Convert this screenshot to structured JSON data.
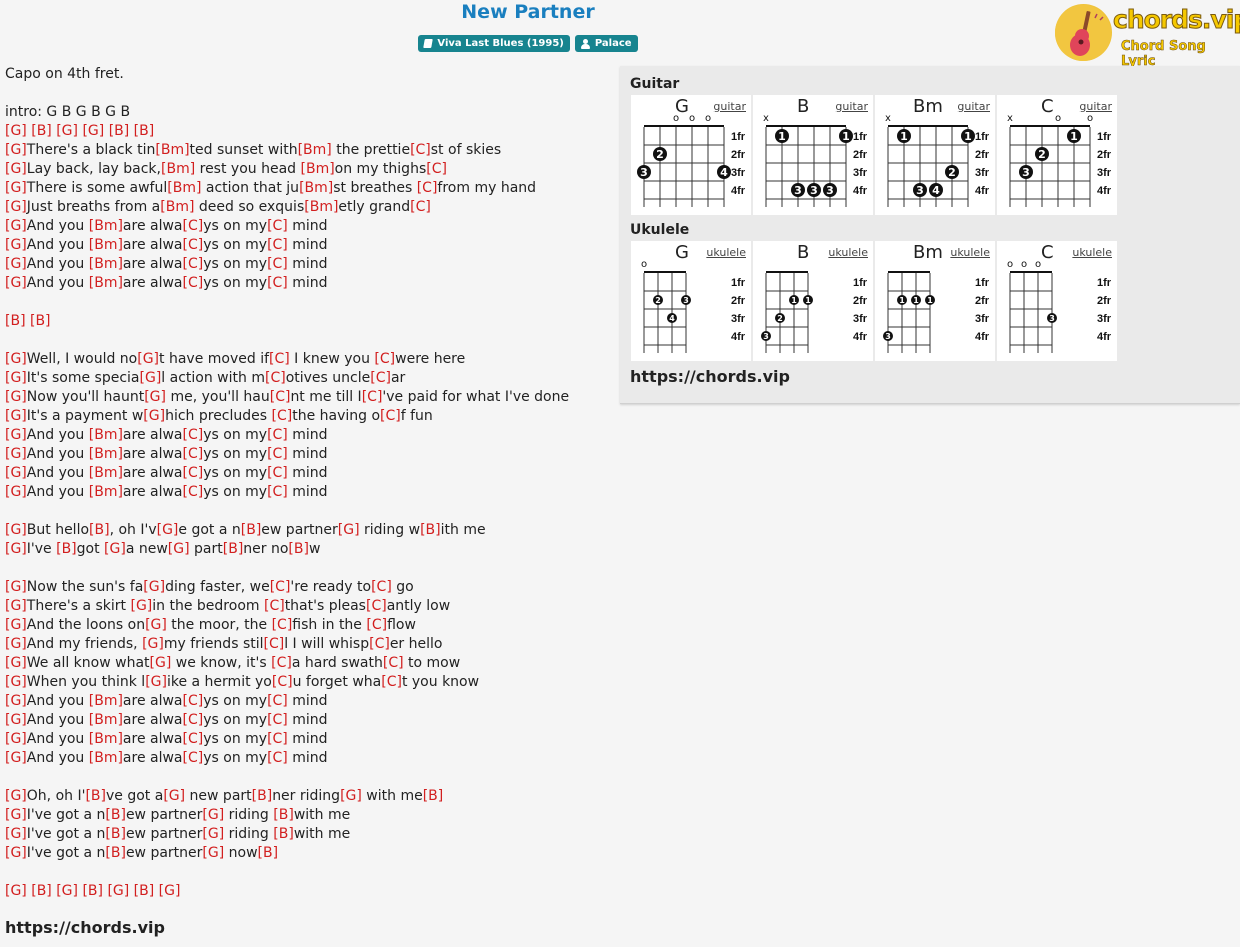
{
  "song": {
    "title": "New Partner",
    "album": "Viva Last Blues (1995)",
    "artist": "Palace"
  },
  "logo": {
    "text": "chords.vip",
    "subtext": "Chord Song Lyric"
  },
  "lyrics": [
    {
      "t": "Capo on 4th fret."
    },
    {
      "t": ""
    },
    {
      "t": "intro: G B G B G B"
    },
    {
      "t": "[G] [B] [G] [G] [B] [B]"
    },
    {
      "t": "[G]There's a black tin[Bm]ted sunset with[Bm] the prettie[C]st of skies"
    },
    {
      "t": "[G]Lay back, lay back,[Bm] rest you head [Bm]on my thighs[C]"
    },
    {
      "t": "[G]There is some awful[Bm] action that ju[Bm]st breathes [C]from my hand"
    },
    {
      "t": "[G]Just breaths from a[Bm] deed so exquis[Bm]etly grand[C]"
    },
    {
      "t": "[G]And you [Bm]are alwa[C]ys on my[C] mind"
    },
    {
      "t": "[G]And you [Bm]are alwa[C]ys on my[C] mind"
    },
    {
      "t": "[G]And you [Bm]are alwa[C]ys on my[C] mind"
    },
    {
      "t": "[G]And you [Bm]are alwa[C]ys on my[C] mind"
    },
    {
      "t": ""
    },
    {
      "t": "[B] [B]"
    },
    {
      "t": ""
    },
    {
      "t": "[G]Well, I would no[G]t have moved if[C] I knew you [C]were here"
    },
    {
      "t": "[G]It's some specia[G]l action with m[C]otives uncle[C]ar"
    },
    {
      "t": "[G]Now you'll haunt[G] me, you'll hau[C]nt me till I[C]'ve paid for what I've done"
    },
    {
      "t": "[G]It's a payment w[G]hich precludes [C]the having o[C]f fun"
    },
    {
      "t": "[G]And you [Bm]are alwa[C]ys on my[C] mind"
    },
    {
      "t": "[G]And you [Bm]are alwa[C]ys on my[C] mind"
    },
    {
      "t": "[G]And you [Bm]are alwa[C]ys on my[C] mind"
    },
    {
      "t": "[G]And you [Bm]are alwa[C]ys on my[C] mind"
    },
    {
      "t": ""
    },
    {
      "t": "[G]But hello[B], oh I'v[G]e got a n[B]ew partner[G] riding w[B]ith me"
    },
    {
      "t": "[G]I've [B]got [G]a new[G] part[B]ner no[B]w"
    },
    {
      "t": ""
    },
    {
      "t": "[G]Now the sun's fa[G]ding faster, we[C]'re ready to[C] go"
    },
    {
      "t": "[G]There's a skirt [G]in the bedroom [C]that's pleas[C]antly low"
    },
    {
      "t": "[G]And the loons on[G] the moor, the [C]fish in the [C]flow"
    },
    {
      "t": "[G]And my friends, [G]my friends stil[C]l I will whisp[C]er hello"
    },
    {
      "t": "[G]We all know what[G] we know, it's [C]a hard swath[C] to mow"
    },
    {
      "t": "[G]When you think l[G]ike a hermit yo[C]u forget wha[C]t you know"
    },
    {
      "t": "[G]And you [Bm]are alwa[C]ys on my[C] mind"
    },
    {
      "t": "[G]And you [Bm]are alwa[C]ys on my[C] mind"
    },
    {
      "t": "[G]And you [Bm]are alwa[C]ys on my[C] mind"
    },
    {
      "t": "[G]And you [Bm]are alwa[C]ys on my[C] mind"
    },
    {
      "t": ""
    },
    {
      "t": "[G]Oh, oh I'[B]ve got a[G] new part[B]ner riding[G] with me[B]"
    },
    {
      "t": "[G]I've got a n[B]ew partner[G] riding [B]with me"
    },
    {
      "t": "[G]I've got a n[B]ew partner[G] riding [B]with me"
    },
    {
      "t": "[G]I've got a n[B]ew partner[G] now[B]"
    },
    {
      "t": ""
    },
    {
      "t": "[G] [B] [G] [B] [G] [B] [G]"
    }
  ],
  "site_url": "https://chords.vip",
  "panel": {
    "guitar_label": "Guitar",
    "ukulele_label": "Ukulele",
    "url": "https://chords.vip",
    "fret_labels": [
      "1fr",
      "2fr",
      "3fr",
      "4fr"
    ],
    "guitar": [
      {
        "name": "G",
        "instrument": "guitar",
        "top": [
          "",
          "",
          "o",
          "o",
          "o",
          ""
        ],
        "dots": [
          {
            "s": 1,
            "f": 2,
            "n": "2"
          },
          {
            "s": 0,
            "f": 3,
            "n": "3"
          },
          {
            "s": 5,
            "f": 3,
            "n": "4"
          }
        ]
      },
      {
        "name": "B",
        "instrument": "guitar",
        "top": [
          "x",
          "",
          "",
          "",
          "",
          ""
        ],
        "dots": [
          {
            "s": 1,
            "f": 1,
            "n": "1"
          },
          {
            "s": 5,
            "f": 1,
            "n": "1"
          },
          {
            "s": 2,
            "f": 4,
            "n": "3"
          },
          {
            "s": 3,
            "f": 4,
            "n": "3"
          },
          {
            "s": 4,
            "f": 4,
            "n": "3"
          }
        ]
      },
      {
        "name": "Bm",
        "instrument": "guitar",
        "top": [
          "x",
          "",
          "",
          "",
          "",
          ""
        ],
        "dots": [
          {
            "s": 1,
            "f": 1,
            "n": "1"
          },
          {
            "s": 5,
            "f": 1,
            "n": "1"
          },
          {
            "s": 4,
            "f": 3,
            "n": "2"
          },
          {
            "s": 2,
            "f": 4,
            "n": "3"
          },
          {
            "s": 3,
            "f": 4,
            "n": "4"
          }
        ]
      },
      {
        "name": "C",
        "instrument": "guitar",
        "top": [
          "x",
          "",
          "",
          "o",
          "",
          "o"
        ],
        "dots": [
          {
            "s": 4,
            "f": 1,
            "n": "1"
          },
          {
            "s": 2,
            "f": 2,
            "n": "2"
          },
          {
            "s": 1,
            "f": 3,
            "n": "3"
          }
        ]
      }
    ],
    "ukulele": [
      {
        "name": "G",
        "instrument": "ukulele",
        "top": [
          "o",
          "",
          "",
          ""
        ],
        "dots": [
          {
            "s": 1,
            "f": 2,
            "n": "2"
          },
          {
            "s": 3,
            "f": 2,
            "n": "3"
          },
          {
            "s": 2,
            "f": 3,
            "n": "4"
          }
        ]
      },
      {
        "name": "B",
        "instrument": "ukulele",
        "top": [
          "",
          "",
          "",
          ""
        ],
        "dots": [
          {
            "s": 2,
            "f": 2,
            "n": "1"
          },
          {
            "s": 3,
            "f": 2,
            "n": "1"
          },
          {
            "s": 1,
            "f": 3,
            "n": "2"
          },
          {
            "s": 0,
            "f": 4,
            "n": "3"
          }
        ]
      },
      {
        "name": "Bm",
        "instrument": "ukulele",
        "top": [
          "",
          "",
          "",
          ""
        ],
        "dots": [
          {
            "s": 1,
            "f": 2,
            "n": "1"
          },
          {
            "s": 2,
            "f": 2,
            "n": "1"
          },
          {
            "s": 3,
            "f": 2,
            "n": "1"
          },
          {
            "s": 0,
            "f": 4,
            "n": "3"
          }
        ]
      },
      {
        "name": "C",
        "instrument": "ukulele",
        "top": [
          "o",
          "o",
          "o",
          ""
        ],
        "dots": [
          {
            "s": 3,
            "f": 3,
            "n": "3"
          }
        ]
      }
    ]
  }
}
